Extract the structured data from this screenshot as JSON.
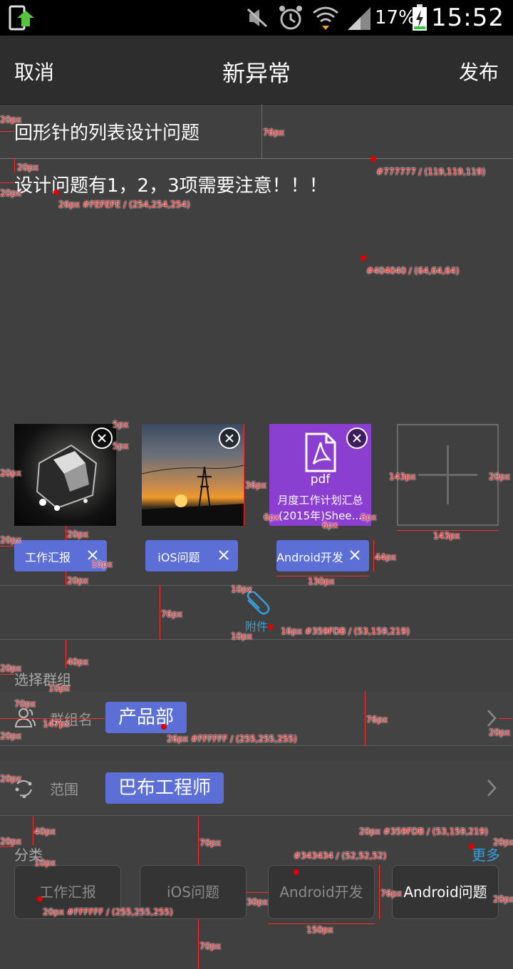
{
  "status": {
    "battery_pct": "17%",
    "time": "15:52"
  },
  "nav": {
    "cancel": "取消",
    "title": "新异常",
    "publish": "发布"
  },
  "form": {
    "title_value": "回形针的列表设计问题",
    "body_value": "设计问题有1，2，3项需要注意！！！"
  },
  "attachments": {
    "pdf_label": "pdf",
    "pdf_name_line1": "月度工作计划汇总",
    "pdf_name_line2": "(2015年)Shee...",
    "tags": [
      "工作汇报",
      "iOS问题",
      "Android开发"
    ],
    "attach_label": "附件"
  },
  "group": {
    "section_label": "选择群组",
    "group_name_label": "群组名",
    "group_value": "产品部",
    "scope_label": "范围",
    "scope_value": "巴布工程师"
  },
  "category": {
    "section_label": "分类",
    "more": "更多",
    "items": [
      "工作汇报",
      "iOS问题",
      "Android开发",
      "Android问题"
    ]
  },
  "colors": {
    "accent": "#359FDB",
    "tag_bg": "#5B6FD6",
    "bg": "#404040",
    "divider": "#777777",
    "cat_bg": "#343434",
    "text": "#FEFEFE"
  },
  "annotations": {
    "a1": "20px",
    "a2": "76px",
    "a3": "20px",
    "a4": "#777777 / (119,119,119)",
    "a5": "20px",
    "a6": "26px #FEFEFE / (254,254,254)",
    "a7": "#404040 / (64,64,64)",
    "a8": "5px",
    "a9": "5px",
    "a10": "20px",
    "a11": "36px",
    "a12": "143px",
    "a13": "20px",
    "a14": "6px",
    "a15": "6px",
    "a16": "6px",
    "a17": "143px",
    "a18": "20px",
    "a19": "20px",
    "a20": "10px",
    "a21": "44px",
    "a22": "20px",
    "a23": "130px",
    "a24": "10px",
    "a25": "76px",
    "a26": "16px #359FDB / (53,159,219)",
    "a27": "10px",
    "a28": "20px",
    "a29": "40px",
    "a30": "10px",
    "a31": "70px",
    "a32": "147px",
    "a33": "20px",
    "a34": "76px",
    "a35": "26px #FFFFFF / (255,255,255)",
    "a36": "20px",
    "a37": "20px",
    "a38": "20px",
    "a39": "40px",
    "a40": "70px",
    "a41": "20px #359FDB / (53,159,219)",
    "a42": "20px",
    "a43": "10px",
    "a44": "#343434 / (52,52,52)",
    "a45": "76px",
    "a46": "20px",
    "a47": "30px",
    "a48": "20px #FFFFFF / (255,255,255)",
    "a49": "150px",
    "a50": "70px"
  }
}
